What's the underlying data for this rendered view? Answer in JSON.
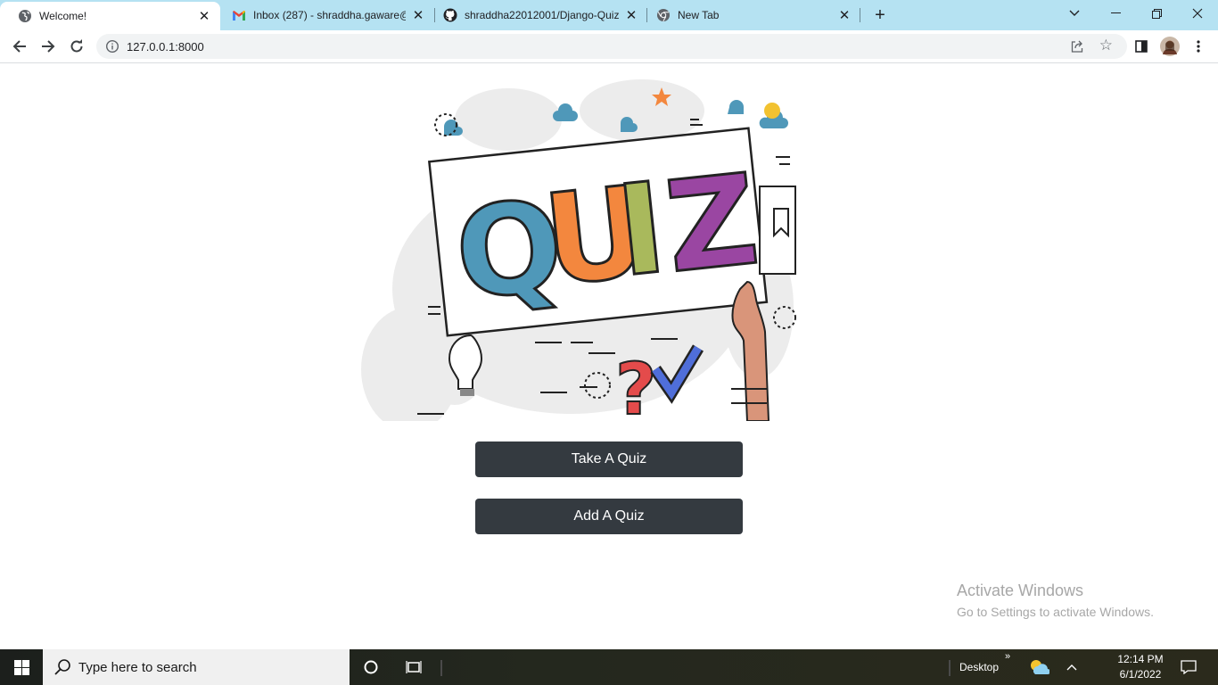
{
  "browser": {
    "tabs": [
      {
        "title": "Welcome!",
        "icon": "globe-icon",
        "active": true
      },
      {
        "title": "Inbox (287) - shraddha.gaware@",
        "icon": "gmail-icon",
        "active": false
      },
      {
        "title": "shraddha22012001/Django-Quiz",
        "icon": "github-icon",
        "active": false
      },
      {
        "title": "New Tab",
        "icon": "chrome-icon",
        "active": false
      }
    ],
    "url": "127.0.0.1:8000"
  },
  "page": {
    "hero_text": "QUIZ",
    "buttons": {
      "take_quiz": "Take A Quiz",
      "add_quiz": "Add A Quiz"
    },
    "watermark": {
      "line1": "Activate Windows",
      "line2": "Go to Settings to activate Windows."
    }
  },
  "taskbar": {
    "search_placeholder": "Type here to search",
    "desktop_label": "Desktop",
    "time": "12:14 PM",
    "date": "6/1/2022"
  },
  "colors": {
    "tabstrip": "#b5e2f2",
    "button_bg": "#343a40",
    "quiz_q": "#4f98b9",
    "quiz_u": "#f3873e",
    "quiz_i": "#a9b95c",
    "quiz_z": "#9a46a2"
  }
}
